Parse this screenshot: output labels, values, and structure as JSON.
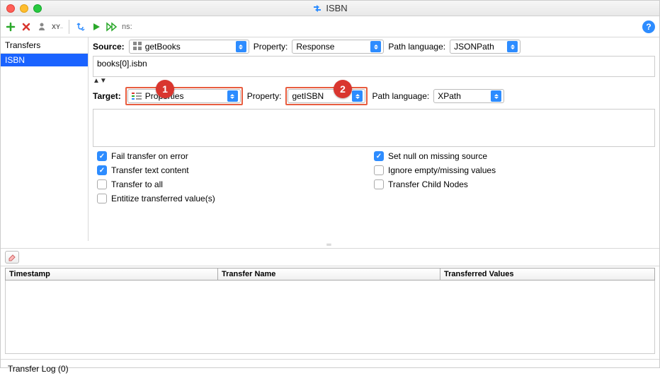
{
  "window": {
    "title": "ISBN"
  },
  "toolbar": {
    "ns_label": "ns:"
  },
  "sidebar": {
    "header": "Transfers",
    "items": [
      "ISBN"
    ]
  },
  "source": {
    "label": "Source:",
    "step": "getBooks",
    "prop_label": "Property:",
    "prop_value": "Response",
    "lang_label": "Path language:",
    "lang_value": "JSONPath",
    "expression": "books[0].isbn"
  },
  "target": {
    "label": "Target:",
    "step": "Properties",
    "prop_label": "Property:",
    "prop_value": "getISBN",
    "lang_label": "Path language:",
    "lang_value": "XPath",
    "expression": ""
  },
  "checks": {
    "fail_on_error": "Fail transfer on error",
    "transfer_text": "Transfer text content",
    "transfer_all": "Transfer to all",
    "entitize": "Entitize transferred value(s)",
    "set_null": "Set null on missing source",
    "ignore_empty": "Ignore empty/missing values",
    "child_nodes": "Transfer Child Nodes"
  },
  "log": {
    "col_timestamp": "Timestamp",
    "col_name": "Transfer Name",
    "col_values": "Transferred Values"
  },
  "footer": {
    "log_label": "Transfer Log (0)"
  },
  "badges": {
    "one": "1",
    "two": "2"
  }
}
